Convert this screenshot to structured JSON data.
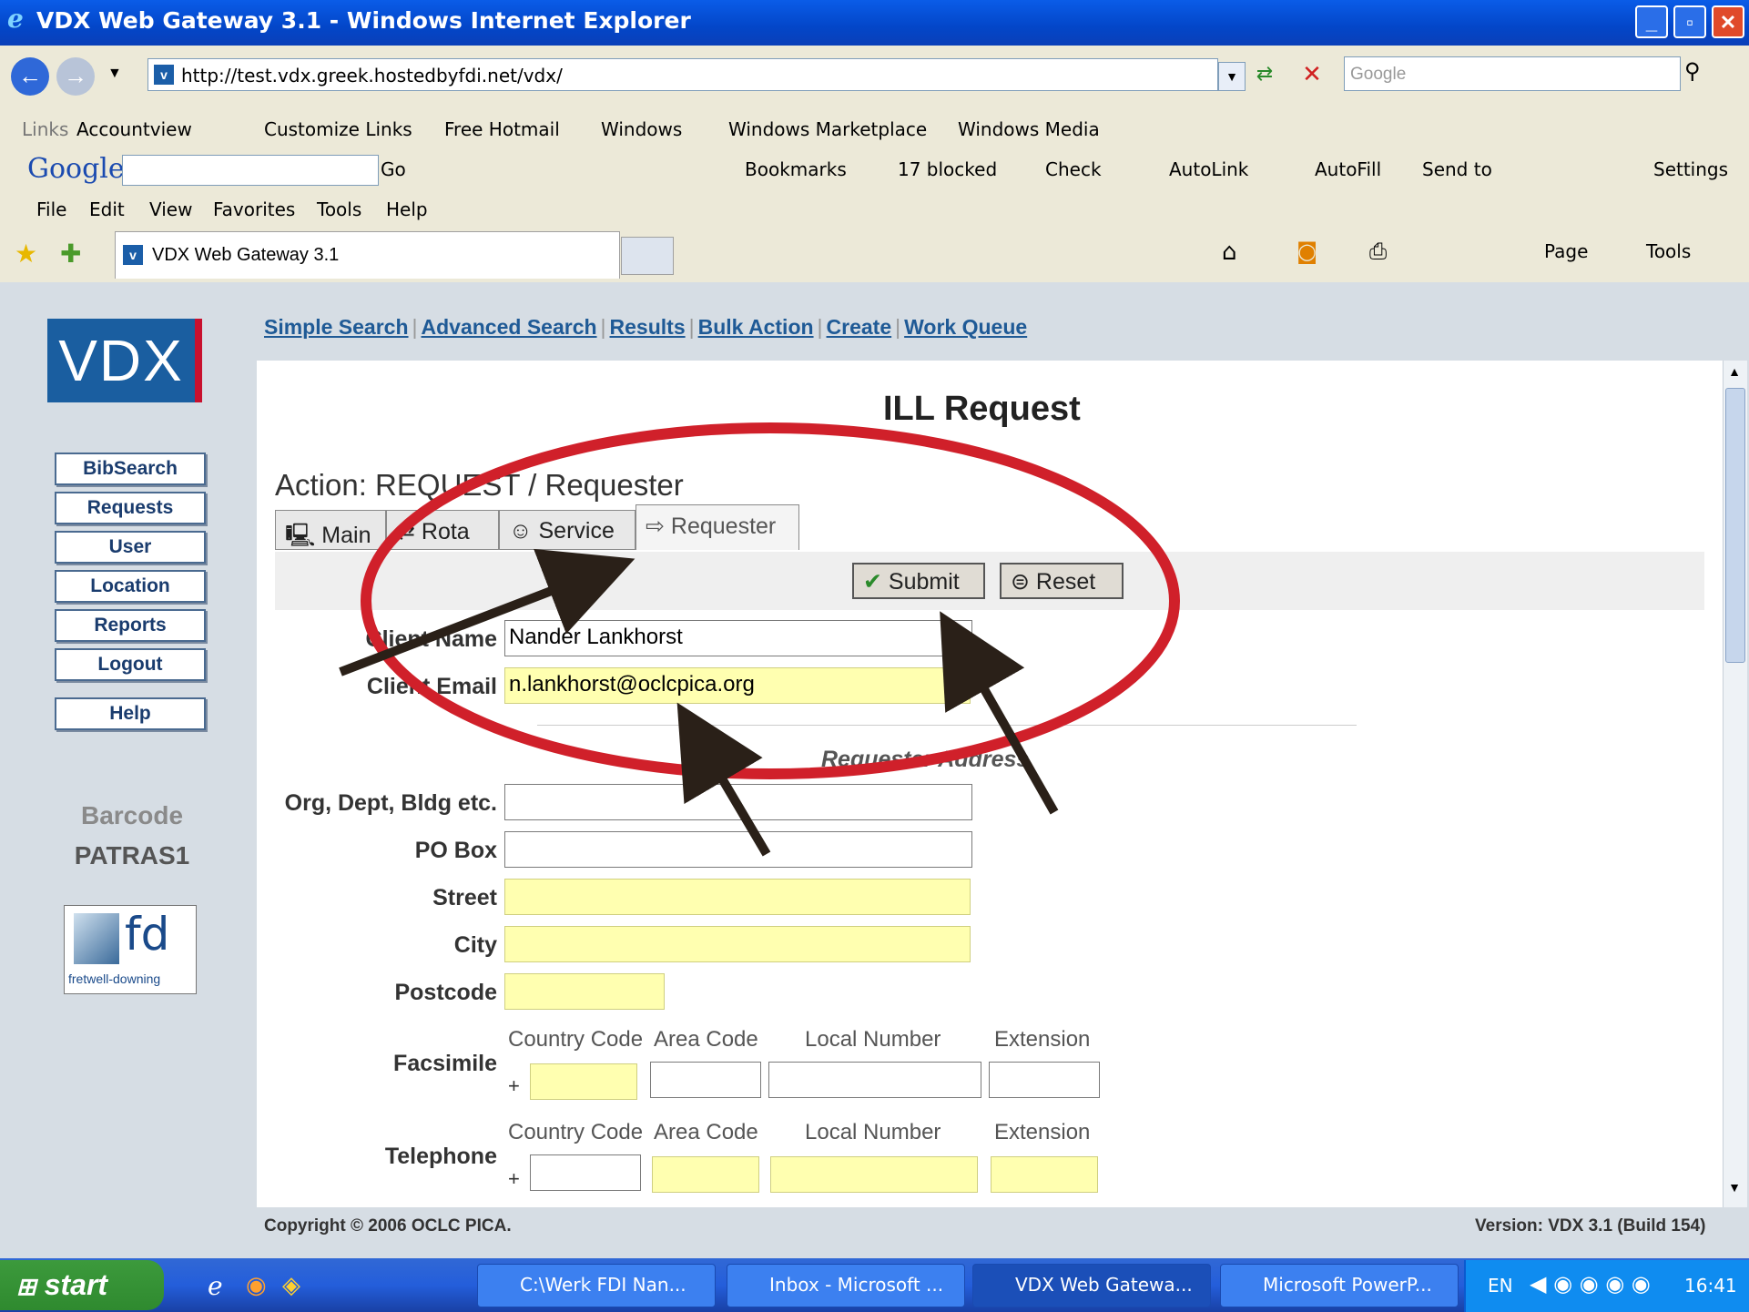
{
  "window": {
    "title": "VDX Web Gateway 3.1 - Windows Internet Explorer"
  },
  "address": {
    "url": "http://test.vdx.greek.hostedbyfdi.net/vdx/",
    "search_placeholder": "Google"
  },
  "links_bar": {
    "label": "Links",
    "items": [
      "Accountview",
      "Customize Links",
      "Free Hotmail",
      "Windows",
      "Windows Marketplace",
      "Windows Media"
    ]
  },
  "google_toolbar": {
    "logo": "Google",
    "go": "Go",
    "bookmarks": "Bookmarks",
    "blocked": "17 blocked",
    "check": "Check",
    "autolink": "AutoLink",
    "autofill": "AutoFill",
    "sendto": "Send to",
    "settings": "Settings"
  },
  "menu": [
    "File",
    "Edit",
    "View",
    "Favorites",
    "Tools",
    "Help"
  ],
  "browser_tab": {
    "title": "VDX Web Gateway 3.1",
    "page_label": "Page",
    "tools_label": "Tools"
  },
  "sidebar": {
    "logo": "VDX",
    "buttons": [
      "BibSearch",
      "Requests",
      "User",
      "Location",
      "Reports",
      "Logout",
      "Help"
    ],
    "barcode_label": "Barcode",
    "barcode_value": "PATRAS1",
    "brand": "fretwell-downing",
    "brand_short": "fd"
  },
  "nav": {
    "links": [
      "Simple Search",
      "Advanced Search",
      "Results",
      "Bulk Action",
      "Create",
      "Work Queue"
    ]
  },
  "page": {
    "title": "ILL Request",
    "action": "Action: REQUEST / Requester",
    "tabs": [
      "Main",
      "Rota",
      "Service",
      "Requester"
    ],
    "submit": "Submit",
    "reset": "Reset",
    "section": "Requester Address",
    "fields": {
      "client_name_label": "Client Name",
      "client_name_value": "Nander Lankhorst",
      "client_email_label": "Client Email",
      "client_email_value": "n.lankhorst@oclcpica.org",
      "org_label": "Org, Dept, Bldg etc.",
      "pobox_label": "PO Box",
      "street_label": "Street",
      "city_label": "City",
      "postcode_label": "Postcode",
      "fax_label": "Facsimile",
      "tel_label": "Telephone",
      "country_code": "Country Code",
      "area_code": "Area Code",
      "local_number": "Local Number",
      "extension": "Extension",
      "plus": "+"
    },
    "copyright": "Copyright © 2006 OCLC PICA.",
    "version": "Version: VDX 3.1 (Build 154)"
  },
  "taskbar": {
    "start": "start",
    "tasks": [
      "C:\\Werk FDI Nan...",
      "Inbox - Microsoft ...",
      "VDX Web Gatewa...",
      "Microsoft PowerP..."
    ],
    "lang": "EN",
    "clock": "16:41"
  },
  "colors": {
    "annotation_ellipse": "#d0202a",
    "arrow": "#2a2018",
    "highlight_field": "#ffffb0",
    "link": "#1f5a96"
  }
}
